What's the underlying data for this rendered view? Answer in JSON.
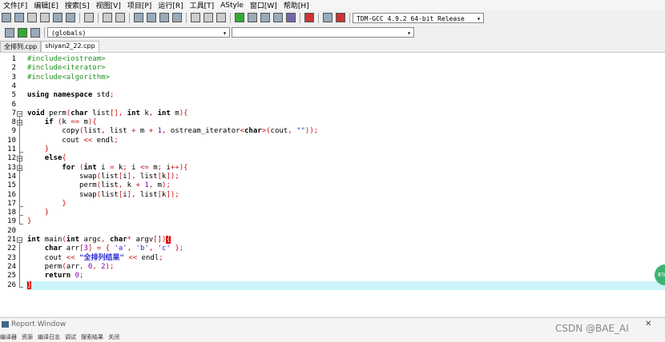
{
  "menu": [
    "文件[F]",
    "编辑[E]",
    "搜索[S]",
    "视图[V]",
    "项目[P]",
    "运行[R]",
    "工具[T]",
    "AStyle",
    "窗口[W]",
    "帮助[H]"
  ],
  "toolbar": {
    "compiler": "TDM-GCC 4.9.2 64-bit Release",
    "scope": "(globals)"
  },
  "tabs": [
    "全排列.cpp",
    "shiyan2_22.cpp"
  ],
  "report": {
    "title": "Report Window",
    "close_glyph": "✕",
    "tabs": [
      "编译器",
      "资源",
      "编译日志",
      "调试",
      "搜索结果",
      "关闭"
    ]
  },
  "watermark": "CSDN @BAE_AI",
  "side_button": "6%",
  "line_numbers": [
    "1",
    "2",
    "3",
    "4",
    "5",
    "6",
    "7",
    "8",
    "9",
    "10",
    "11",
    "12",
    "13",
    "14",
    "15",
    "16",
    "17",
    "18",
    "19",
    "20",
    "21",
    "22",
    "23",
    "24",
    "25",
    "26"
  ]
}
